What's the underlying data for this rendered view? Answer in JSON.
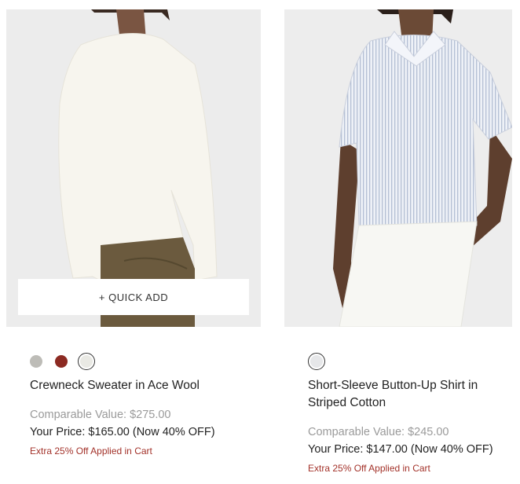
{
  "products": [
    {
      "quick_add_label": "+ QUICK ADD",
      "swatch_colors": [
        "#bdbcb7",
        "#8c2a22",
        "#e9e9e4"
      ],
      "name": "Crewneck Sweater in Ace Wool",
      "comparable": "Comparable Value: $275.00",
      "price": "Your Price: $165.00 (Now 40% OFF)",
      "extra": "Extra 25% Off Applied in Cart"
    },
    {
      "swatch_colors": [
        "#e6e7e9"
      ],
      "name": "Short-Sleeve Button-Up Shirt in Striped Cotton",
      "comparable": "Comparable Value: $245.00",
      "price": "Your Price: $147.00 (Now 40% OFF)",
      "extra": "Extra 25% Off Applied in Cart"
    }
  ]
}
